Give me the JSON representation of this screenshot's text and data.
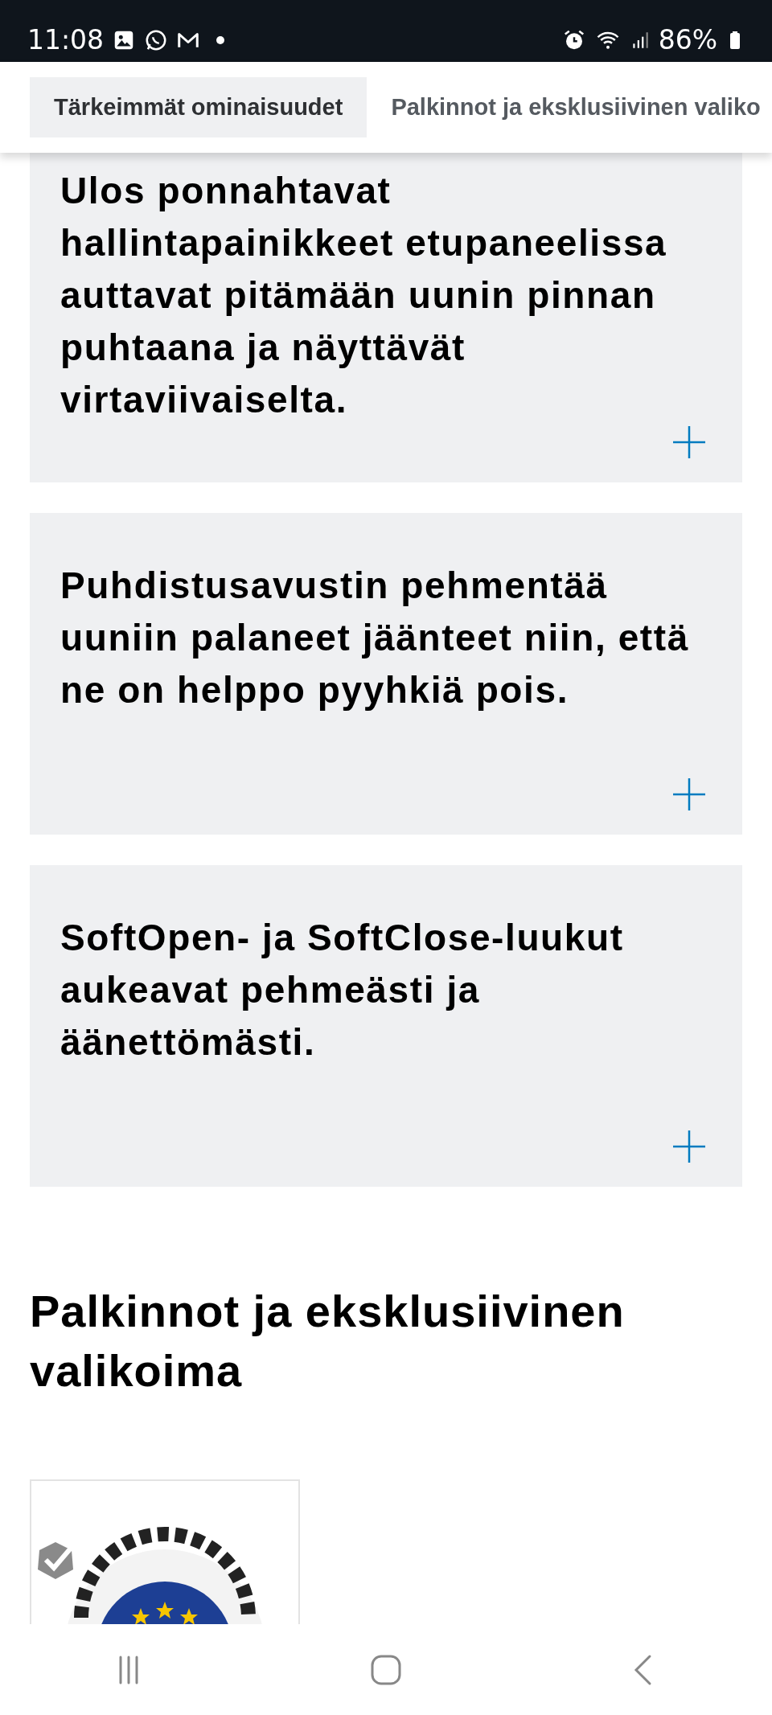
{
  "status_bar": {
    "time": "11:08",
    "battery": "86%"
  },
  "tabs": [
    {
      "label": "Tärkeimmät ominaisuudet",
      "selected": true
    },
    {
      "label": "Palkinnot ja eksklusiivinen valiko",
      "selected": false
    }
  ],
  "features": [
    {
      "text": "Ulos ponnahtavat hallintapainikkeet etupaneelissa auttavat pitämään uunin pinnan puhtaana ja näyttävät virtaviivaiselta.",
      "expanded": false
    },
    {
      "text": "Puhdistusavustin pehmentää uuniin palaneet jäänteet niin, että ne on helppo pyyhkiä pois.",
      "expanded": false
    },
    {
      "text": "SoftOpen- ja SoftClose-luukut aukeavat pehmeästi ja äänettömästi.",
      "expanded": false
    }
  ],
  "awards": {
    "heading": "Palkinnot ja eksklusiivinen valikoima"
  }
}
